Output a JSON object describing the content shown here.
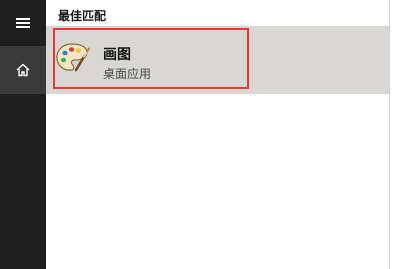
{
  "sidebar": {
    "items": [
      {
        "icon": "hamburger-menu-icon"
      },
      {
        "icon": "home-icon"
      }
    ]
  },
  "best_match": {
    "header": "最佳匹配",
    "result": {
      "title": "画图",
      "subtitle": "桌面应用",
      "icon": "paint-palette-icon"
    },
    "highlight_color": "#e53935"
  }
}
